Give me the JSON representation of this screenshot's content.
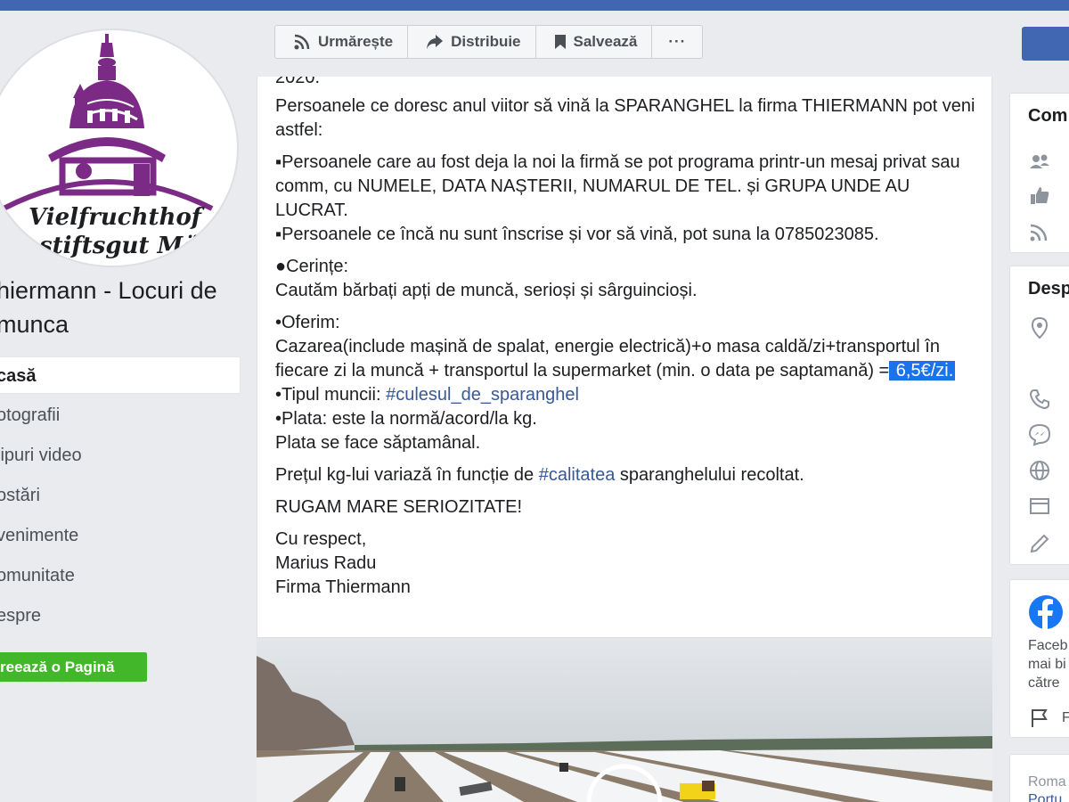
{
  "logo": {
    "text1": "Vielfruchthof",
    "text2": "stiftsgut Mö"
  },
  "page_name": "hiermann - Locuri de munca",
  "nav": [
    "casă",
    "otografii",
    "lipuri video",
    "ostări",
    "venimente",
    "omunitate",
    "espre"
  ],
  "create_page": "reează o Pagină",
  "actions": {
    "follow": "Urmărește",
    "share": "Distribuie",
    "save": "Salvează",
    "more": "···"
  },
  "post": {
    "cut_line": "2020.",
    "p1": "Persoanele ce doresc anul viitor să vină la SPARANGHEL la firma THIERMANN pot veni astfel:",
    "p2a": "▪Persoanele care au fost deja la noi la firmă se pot programa printr-un mesaj privat sau comm, cu NUMELE, DATA NAȘTERII, NUMARUL DE TEL. și GRUPA UNDE AU LUCRAT.",
    "p2b": "▪Persoanele ce încă nu sunt înscrise și vor să vină, pot suna la 0785023085.",
    "req_title": "●Cerințe:",
    "req_text": "Cautăm bărbați apți de muncă, serioși și sârguincioși.",
    "offer_title": "•Oferim:",
    "offer_text": "Cazarea(include mașină de spalat, energie electrică)+o masa caldă/zi+transportul în fiecare zi la muncă + transportul la supermarket (min. o data pe saptamană) =",
    "offer_price": " 6,5€/zi.",
    "work_label": "•Tipul muncii: ",
    "work_tag": "#culesul_de_sparanghel",
    "pay1": "•Plata: este la normă/acord/la kg.",
    "pay2": "Plata se face săptamânal.",
    "price_a": "Prețul kg-lui variază în funcție de ",
    "price_tag": "#calitatea",
    "price_b": " sparanghelului recoltat.",
    "serious": "RUGAM MARE SERIOZITATE!",
    "sign1": "Cu respect,",
    "sign2": "Marius Radu",
    "sign3": "Firma Thiermann"
  },
  "right": {
    "community_title": "Com",
    "about_title": "Desp",
    "fb_text1": "Faceb",
    "fb_text2": "mai bi",
    "fb_text3": "către",
    "fb_flag_text": "F",
    "lang1": "Roma",
    "lang2": "Portu"
  },
  "colors": {
    "accent": "#4267b2",
    "link": "#385898",
    "green": "#42b72a",
    "logo_purple": "#7b2a86"
  }
}
